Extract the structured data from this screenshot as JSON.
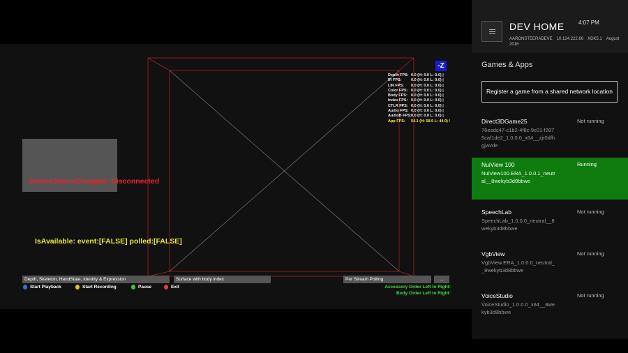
{
  "viewer": {
    "z_badge": "-Z",
    "fps": [
      {
        "label": "Depth FPS:",
        "value": "0.0 (H: 0.0 L: 0.0) |"
      },
      {
        "label": "IR FPS:",
        "value": "0.0 (H: 0.0 L: 0.0) |"
      },
      {
        "label": "LIR FPS:",
        "value": "0.0 (H: 0.0 L: 0.0) |"
      },
      {
        "label": "Color FPS:",
        "value": "0.0 (H: 0.0 L: 0.0) |"
      },
      {
        "label": "Body FPS:",
        "value": "0.0 (H: 0.0 L: 0.0) |"
      },
      {
        "label": "Index FPS:",
        "value": "0.0 (H: 0.0 L: 0.0) |"
      },
      {
        "label": "CTLR FPS:",
        "value": "0.0 (H: 0.0 L: 0.0) |"
      },
      {
        "label": "Audio FPS:",
        "value": "0.0 (H: 0.0 L: 0.0) |"
      },
      {
        "label": "AudioB FPS:",
        "value": "0.0 (H: 0.0 L: 0.0) |"
      },
      {
        "label": "App FPS:",
        "value": "54.1 (H: 58.9 L: 44.0) /"
      }
    ],
    "device_status": "DeviceStatusChanged: Disconnected",
    "is_available": "IsAvailable: event:[FALSE] polled:[FALSE]",
    "combo_stream": "Depth, Skeleton, HandState, Identity & Expression",
    "combo_surface": "Surface with body index",
    "combo_polling": "Per Stream Polling",
    "combo_more": "...",
    "legend": [
      {
        "label": "Start Playback",
        "color": "#3a6fd8"
      },
      {
        "label": "Start Recording",
        "color": "#e0c030"
      },
      {
        "label": "Pause",
        "color": "#3cc83c"
      },
      {
        "label": "Exit",
        "color": "#e04040"
      }
    ],
    "accessory_order": "Accessory Order Left to Right:",
    "body_order": "Body Order Left to Right:"
  },
  "devhome": {
    "title": "DEV HOME",
    "time": "4:07 PM",
    "device_name": "AARONSTEERADEVE",
    "ip": "10.124.222.66",
    "console": "XDK5.1",
    "date": "August 2016",
    "section_title": "Games & Apps",
    "register_label": "Register a game from a shared network location",
    "apps": [
      {
        "name": "Direct3DGame25",
        "package": "76eedc47-c1b2-4f8c-9c01-f2875caf1de2_1.0.0.0_x64__zjr0dfhgjwvde",
        "status": "Not running"
      },
      {
        "name": "NuiView 100",
        "package": "NuiView100.ERA_1.0.0.1_neutral__8wekyb3d8bbwe",
        "status": "Running"
      },
      {
        "name": "SpeechLab",
        "package": "SpeechLab_1.0.0.0_neutral__8wekyb3d8bbwe",
        "status": "Not running"
      },
      {
        "name": "VgbView",
        "package": "VgbView.ERA_1.0.0.0_neutral__8wekyb3d8bbwe",
        "status": "Not running"
      },
      {
        "name": "VoiceStudio",
        "package": "VoiceStudio_1.0.0.0_x64__8wekyb3d8bbwe",
        "status": "Not running"
      }
    ],
    "active_color": "#107c10"
  }
}
